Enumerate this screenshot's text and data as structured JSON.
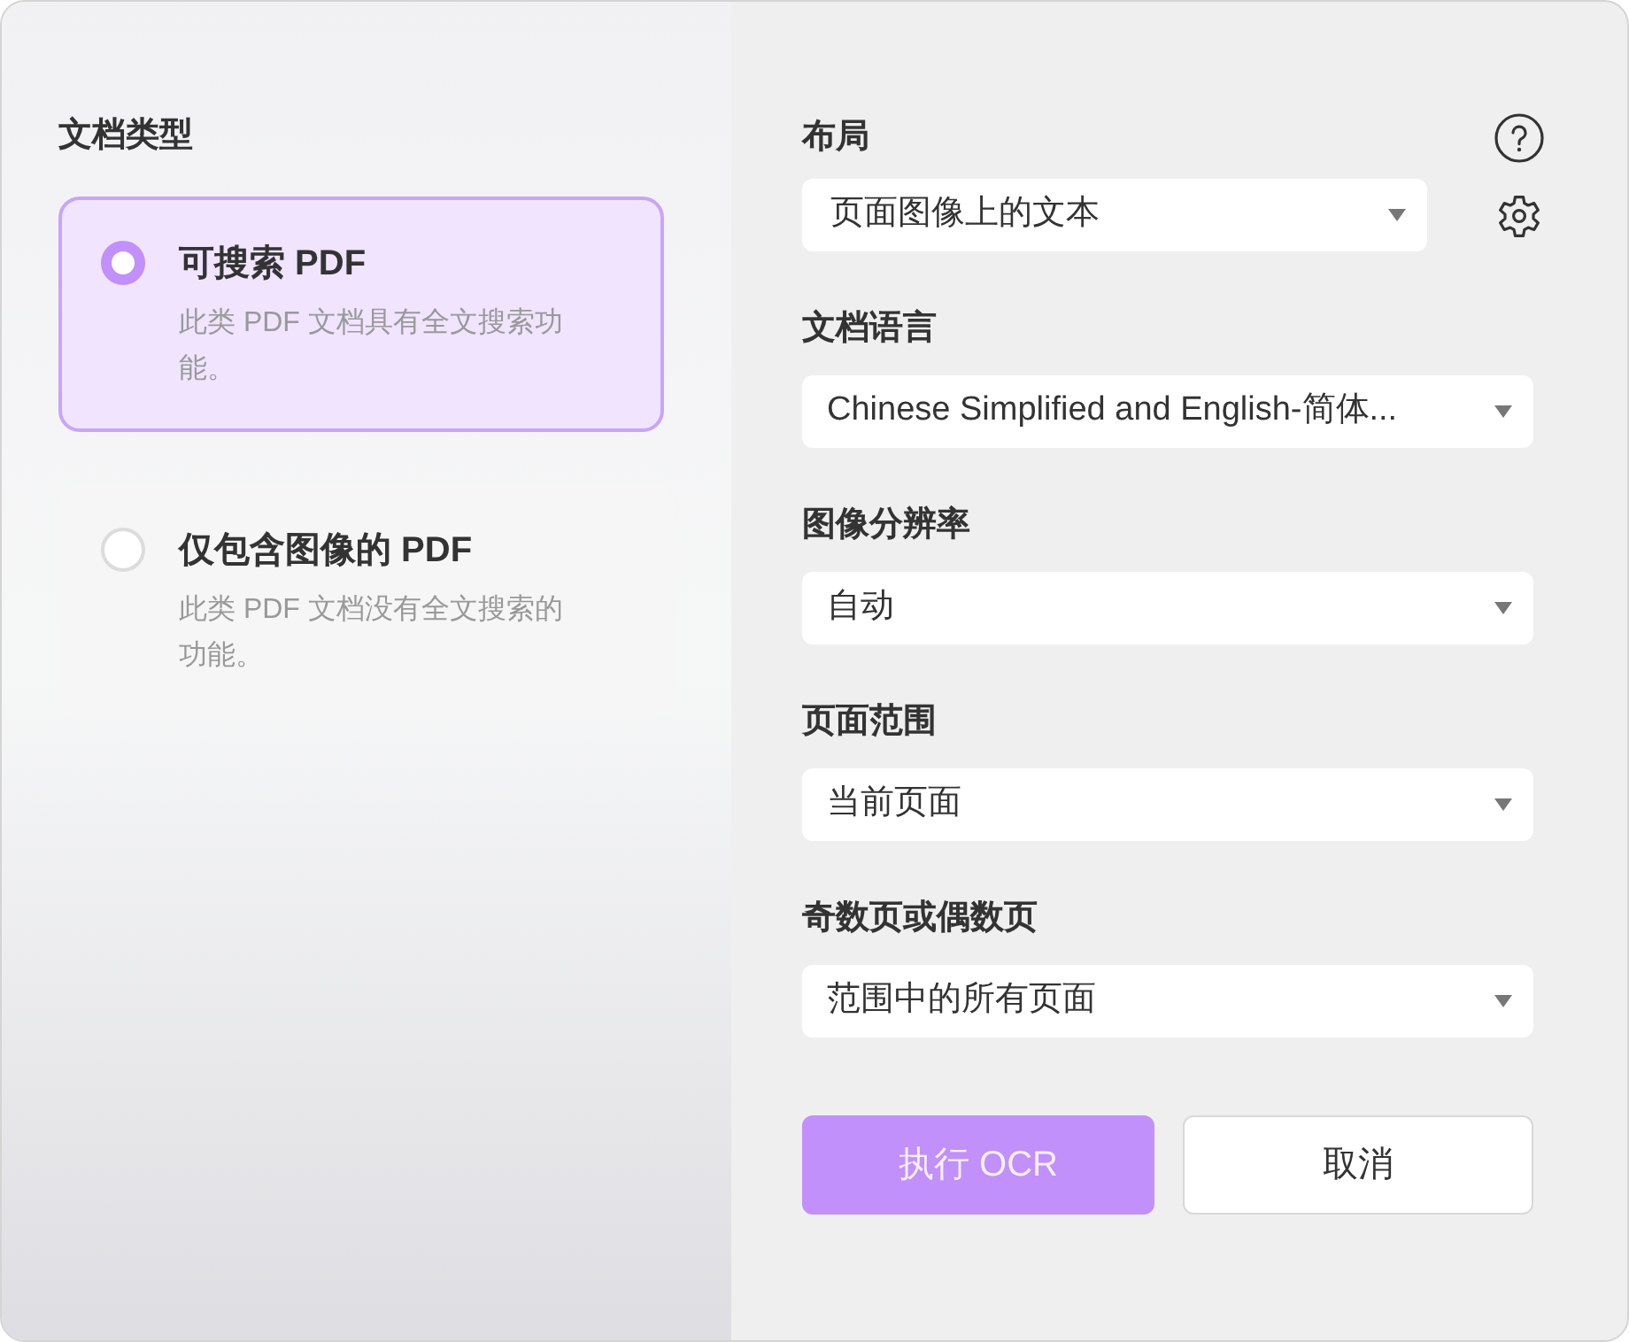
{
  "document_type": {
    "title": "文档类型",
    "options": [
      {
        "label": "可搜索 PDF",
        "description": "此类 PDF 文档具有全文搜索功能。",
        "selected": true
      },
      {
        "label": "仅包含图像的 PDF",
        "description": "此类 PDF 文档没有全文搜索的功能。",
        "selected": false
      }
    ]
  },
  "layout": {
    "label": "布局",
    "value": "页面图像上的文本"
  },
  "settings": [
    {
      "label": "文档语言",
      "value": "Chinese Simplified and English-简体..."
    },
    {
      "label": "图像分辨率",
      "value": "自动"
    },
    {
      "label": "页面范围",
      "value": "当前页面"
    },
    {
      "label": "奇数页或偶数页",
      "value": "范围中的所有页面"
    }
  ],
  "buttons": [
    {
      "label": "执行 OCR",
      "kind": "primary"
    },
    {
      "label": "取消",
      "kind": "secondary"
    }
  ]
}
